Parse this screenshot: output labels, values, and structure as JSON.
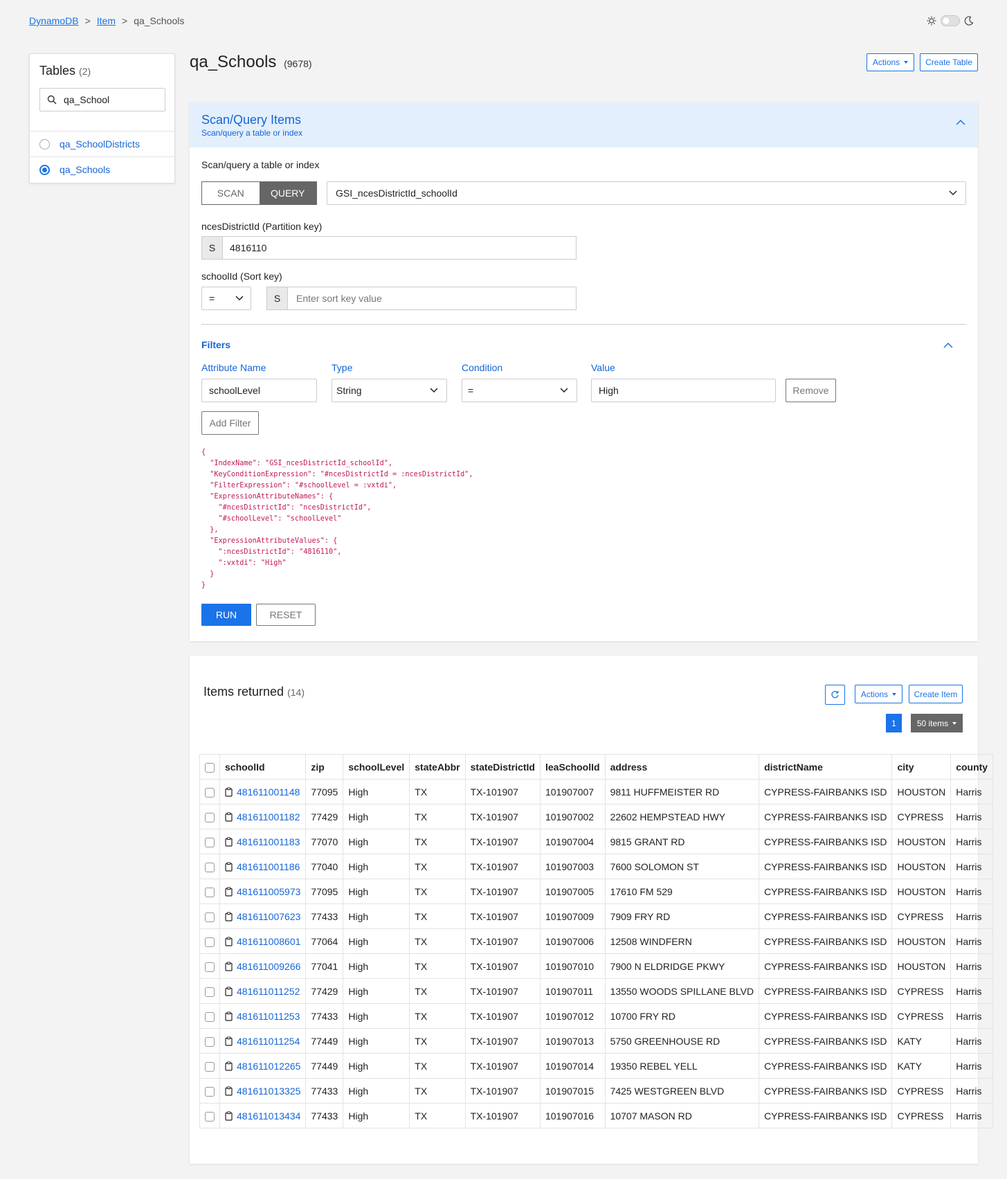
{
  "breadcrumb": {
    "root": "DynamoDB",
    "item": "Item",
    "current": "qa_Schools",
    "sep": ">"
  },
  "sidebar": {
    "title": "Tables",
    "count": "(2)",
    "search_value": "qa_School",
    "items": [
      {
        "label": "qa_SchoolDistricts",
        "selected": false
      },
      {
        "label": "qa_Schools",
        "selected": true
      }
    ]
  },
  "header": {
    "title": "qa_Schools",
    "count": "(9678)",
    "actions_label": "Actions",
    "create_table_label": "Create Table"
  },
  "scan": {
    "title": "Scan/Query Items",
    "subtitle": "Scan/query a table or index",
    "section_label": "Scan/query a table or index",
    "mode_scan": "SCAN",
    "mode_query": "QUERY",
    "active_mode": "QUERY",
    "index": "GSI_ncesDistrictId_schoolId",
    "partition_label": "ncesDistrictId (Partition key)",
    "partition_type": "S",
    "partition_value": "4816110",
    "sort_label": "schoolId (Sort key)",
    "sort_operator": "=",
    "sort_type": "S",
    "sort_placeholder": "Enter sort key value",
    "filters_title": "Filters",
    "filter_headers": {
      "attr": "Attribute Name",
      "type": "Type",
      "cond": "Condition",
      "value": "Value"
    },
    "filter": {
      "attr": "schoolLevel",
      "type": "String",
      "cond": "=",
      "value": "High"
    },
    "remove_label": "Remove",
    "add_filter_label": "Add Filter",
    "query_json": "{\n  \"IndexName\": \"GSI_ncesDistrictId_schoolId\",\n  \"KeyConditionExpression\": \"#ncesDistrictId = :ncesDistrictId\",\n  \"FilterExpression\": \"#schoolLevel = :vxtdi\",\n  \"ExpressionAttributeNames\": {\n    \"#ncesDistrictId\": \"ncesDistrictId\",\n    \"#schoolLevel\": \"schoolLevel\"\n  },\n  \"ExpressionAttributeValues\": {\n    \":ncesDistrictId\": \"4816110\",\n    \":vxtdi\": \"High\"\n  }\n}",
    "run_label": "RUN",
    "reset_label": "RESET"
  },
  "results": {
    "title": "Items returned",
    "count": "(14)",
    "actions_label": "Actions",
    "create_item_label": "Create Item",
    "page": "1",
    "per_page": "50 items",
    "columns": [
      "schoolId",
      "zip",
      "schoolLevel",
      "stateAbbr",
      "stateDistrictId",
      "leaSchoolId",
      "address",
      "districtName",
      "city",
      "county"
    ],
    "rows": [
      [
        "481611001148",
        "77095",
        "High",
        "TX",
        "TX-101907",
        "101907007",
        "9811 HUFFMEISTER RD",
        "CYPRESS-FAIRBANKS ISD",
        "HOUSTON",
        "Harris"
      ],
      [
        "481611001182",
        "77429",
        "High",
        "TX",
        "TX-101907",
        "101907002",
        "22602 HEMPSTEAD HWY",
        "CYPRESS-FAIRBANKS ISD",
        "CYPRESS",
        "Harris"
      ],
      [
        "481611001183",
        "77070",
        "High",
        "TX",
        "TX-101907",
        "101907004",
        "9815 GRANT RD",
        "CYPRESS-FAIRBANKS ISD",
        "HOUSTON",
        "Harris"
      ],
      [
        "481611001186",
        "77040",
        "High",
        "TX",
        "TX-101907",
        "101907003",
        "7600 SOLOMON ST",
        "CYPRESS-FAIRBANKS ISD",
        "HOUSTON",
        "Harris"
      ],
      [
        "481611005973",
        "77095",
        "High",
        "TX",
        "TX-101907",
        "101907005",
        "17610 FM 529",
        "CYPRESS-FAIRBANKS ISD",
        "HOUSTON",
        "Harris"
      ],
      [
        "481611007623",
        "77433",
        "High",
        "TX",
        "TX-101907",
        "101907009",
        "7909 FRY RD",
        "CYPRESS-FAIRBANKS ISD",
        "CYPRESS",
        "Harris"
      ],
      [
        "481611008601",
        "77064",
        "High",
        "TX",
        "TX-101907",
        "101907006",
        "12508 WINDFERN",
        "CYPRESS-FAIRBANKS ISD",
        "HOUSTON",
        "Harris"
      ],
      [
        "481611009266",
        "77041",
        "High",
        "TX",
        "TX-101907",
        "101907010",
        "7900 N ELDRIDGE PKWY",
        "CYPRESS-FAIRBANKS ISD",
        "HOUSTON",
        "Harris"
      ],
      [
        "481611011252",
        "77429",
        "High",
        "TX",
        "TX-101907",
        "101907011",
        "13550 WOODS SPILLANE BLVD",
        "CYPRESS-FAIRBANKS ISD",
        "CYPRESS",
        "Harris"
      ],
      [
        "481611011253",
        "77433",
        "High",
        "TX",
        "TX-101907",
        "101907012",
        "10700 FRY RD",
        "CYPRESS-FAIRBANKS ISD",
        "CYPRESS",
        "Harris"
      ],
      [
        "481611011254",
        "77449",
        "High",
        "TX",
        "TX-101907",
        "101907013",
        "5750 GREENHOUSE RD",
        "CYPRESS-FAIRBANKS ISD",
        "KATY",
        "Harris"
      ],
      [
        "481611012265",
        "77449",
        "High",
        "TX",
        "TX-101907",
        "101907014",
        "19350 REBEL YELL",
        "CYPRESS-FAIRBANKS ISD",
        "KATY",
        "Harris"
      ],
      [
        "481611013325",
        "77433",
        "High",
        "TX",
        "TX-101907",
        "101907015",
        "7425 WESTGREEN BLVD",
        "CYPRESS-FAIRBANKS ISD",
        "CYPRESS",
        "Harris"
      ],
      [
        "481611013434",
        "77433",
        "High",
        "TX",
        "TX-101907",
        "101907016",
        "10707 MASON RD",
        "CYPRESS-FAIRBANKS ISD",
        "CYPRESS",
        "Harris"
      ]
    ]
  },
  "colors": {
    "accent": "#1a73e8",
    "link": "#1565d8",
    "header_bg": "#e3effc",
    "code": "#c2185b"
  }
}
